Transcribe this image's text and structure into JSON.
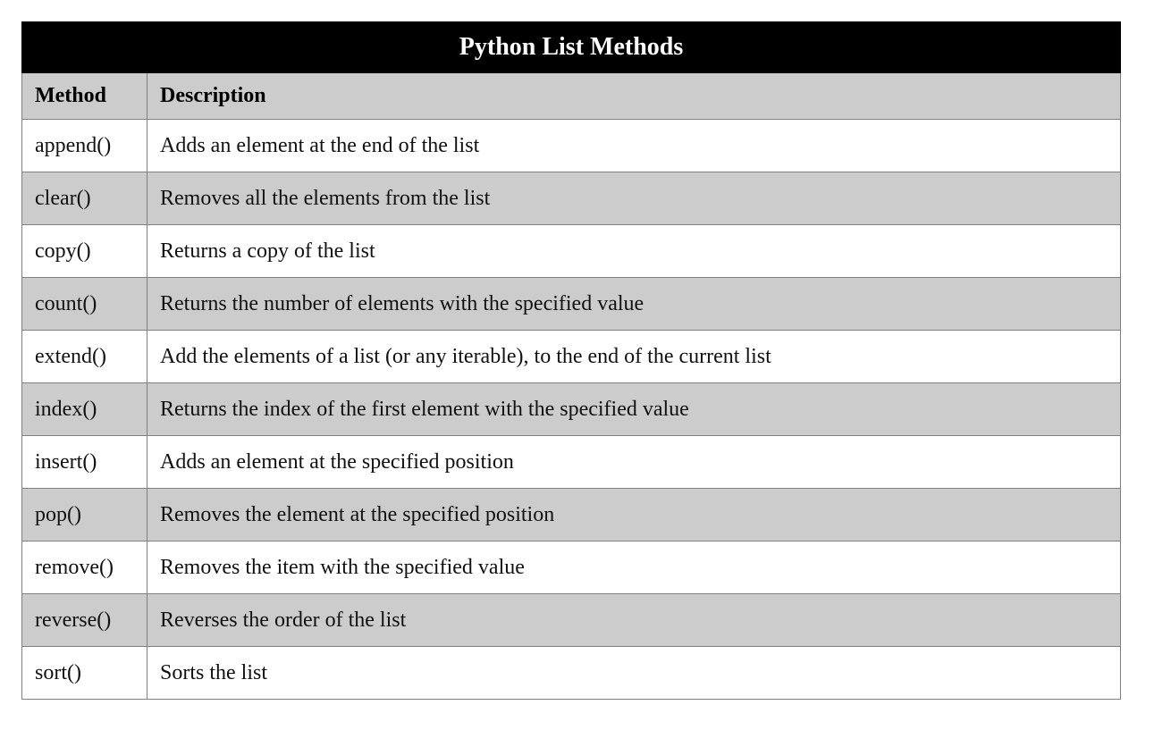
{
  "title": "Python List Methods",
  "columns": {
    "method": "Method",
    "description": "Description"
  },
  "rows": [
    {
      "method": "append()",
      "description": "Adds an element at the end of the list"
    },
    {
      "method": "clear()",
      "description": "Removes all the elements from the list"
    },
    {
      "method": "copy()",
      "description": "Returns a copy of the list"
    },
    {
      "method": "count()",
      "description": "Returns the number of elements with the specified value"
    },
    {
      "method": "extend()",
      "description": "Add the elements of a list (or any iterable), to the end of the current list"
    },
    {
      "method": "index()",
      "description": "Returns the index of the first element with the specified value"
    },
    {
      "method": "insert()",
      "description": "Adds an element at the specified position"
    },
    {
      "method": "pop()",
      "description": "Removes the element at the specified position"
    },
    {
      "method": "remove()",
      "description": "Removes the item with the specified value"
    },
    {
      "method": "reverse()",
      "description": "Reverses the order of the list"
    },
    {
      "method": "sort()",
      "description": "Sorts the list"
    }
  ]
}
